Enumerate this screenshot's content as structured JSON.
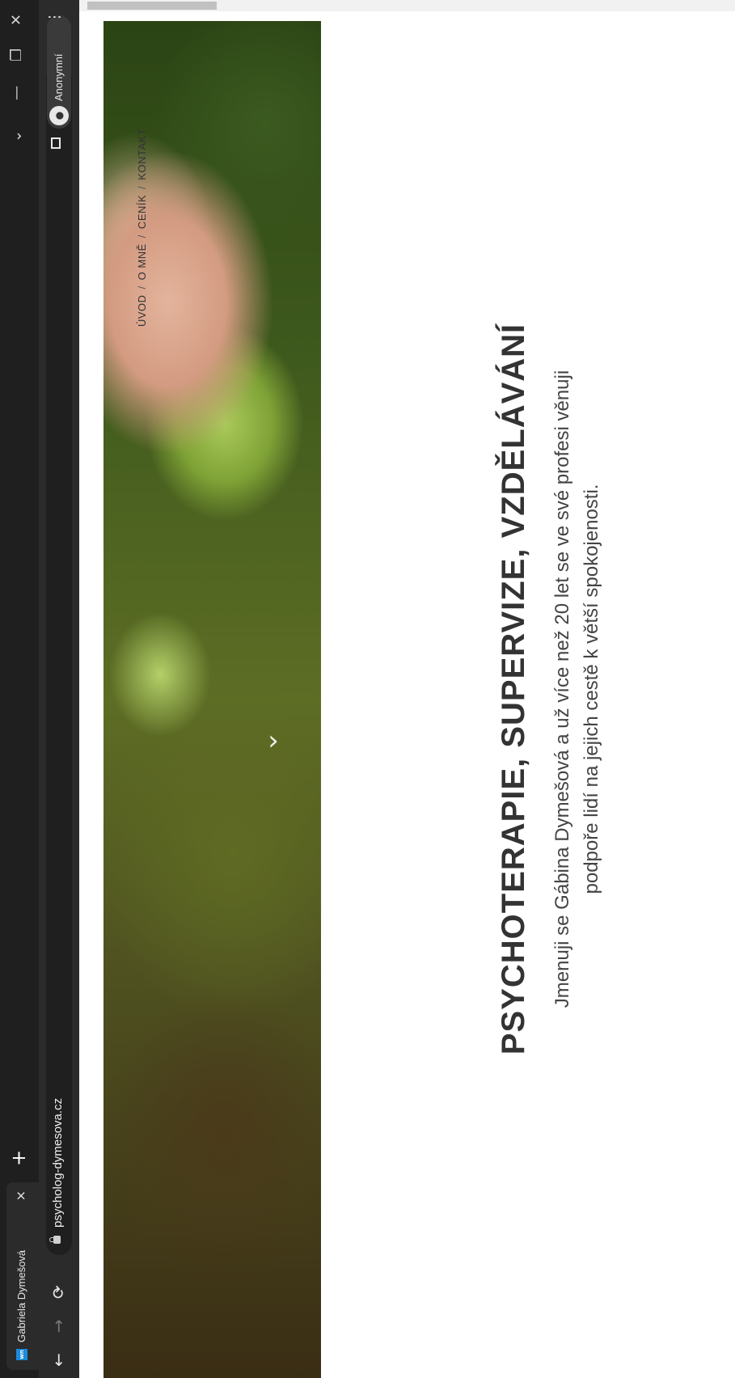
{
  "browser": {
    "tab_title": "Gabriela Dymešová",
    "favicon_text": "wn",
    "tab_close": "×",
    "new_tab": "+",
    "url": "psycholog-dymesova.cz",
    "profile_label": "Anonymní",
    "menu": "⋮",
    "back": "←",
    "forward": "→",
    "reload": "⟳",
    "star": "☆",
    "minimize": "—",
    "restore": "❐",
    "close": "✕",
    "chevron": "⌄"
  },
  "nav": {
    "uvod": "ÚVOD",
    "o_mne": "O MNĚ",
    "cenik": "CENÍK",
    "kontakt": "KONTAKT",
    "separator": "/"
  },
  "hero": {
    "next_arrow": "›"
  },
  "main": {
    "headline": "PSYCHOTERAPIE, SUPERVIZE, VZDĚLÁVÁNÍ",
    "subtext_line1": "Jmenuji se Gábina Dymešová a už více než 20 let se ve své profesi věnuji",
    "subtext_line2": "podpoře lidí na jejich cestě k větší spokojenosti."
  }
}
